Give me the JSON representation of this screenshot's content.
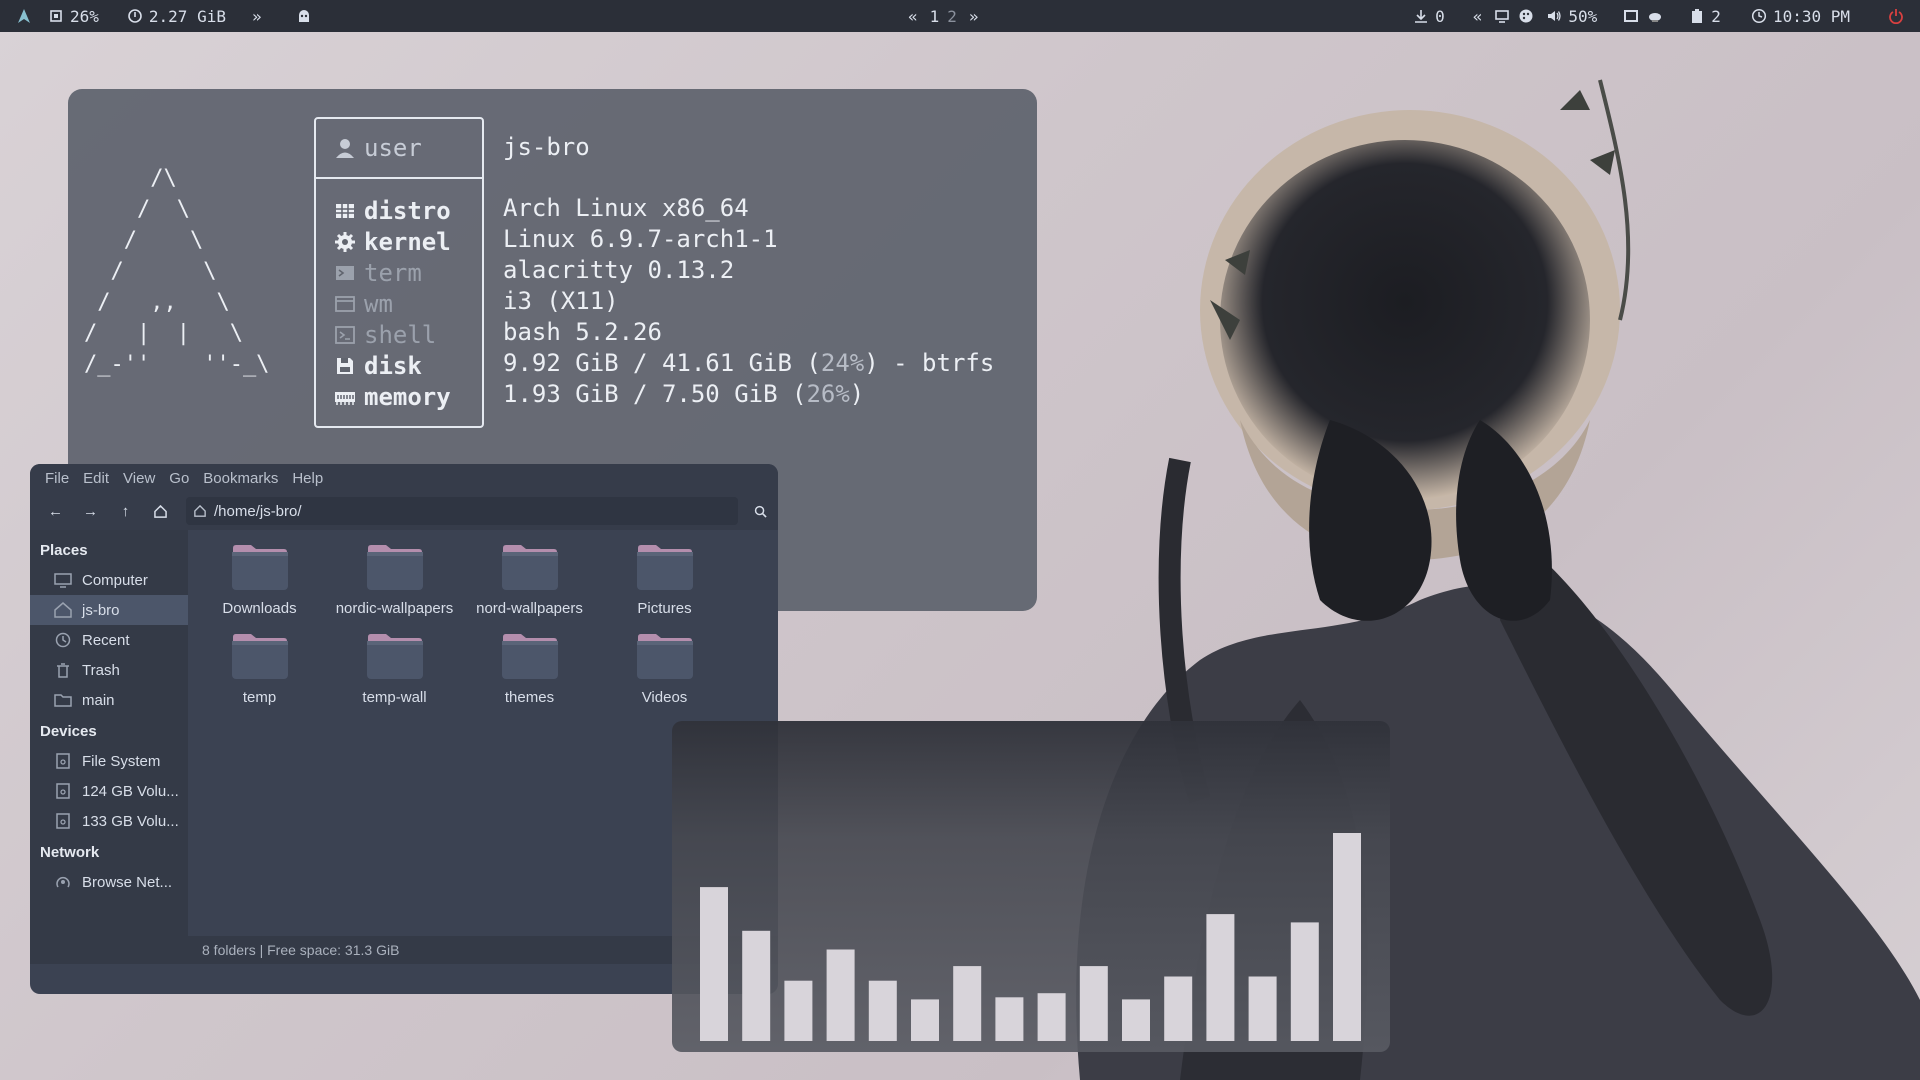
{
  "topbar": {
    "cpu": "26%",
    "mem": "2.27 GiB",
    "workspaces": [
      "1",
      "2"
    ],
    "downloads": "0",
    "volume": "50%",
    "clipboard": "2",
    "clock": "10:30 PM"
  },
  "fetch": {
    "ascii": "     /\\\n    /  \\\n   /    \\\n  /      \\\n /   ,,   \\\n/   |  |   \\\n/_-''    ''-_\\",
    "user_label": "user",
    "user_value": "js-bro",
    "rows": [
      {
        "key": "distro",
        "value": "Arch Linux x86_64",
        "bright": true,
        "icon": "package-icon"
      },
      {
        "key": "kernel",
        "value": "Linux 6.9.7-arch1-1",
        "bright": true,
        "icon": "gear-icon"
      },
      {
        "key": "term",
        "value": "alacritty 0.13.2",
        "bright": false,
        "icon": "terminal-icon"
      },
      {
        "key": "wm",
        "value": "i3 (X11)",
        "bright": false,
        "icon": "window-icon"
      },
      {
        "key": "shell",
        "value": "bash 5.2.26",
        "bright": false,
        "icon": "shell-icon"
      },
      {
        "key": "disk",
        "value_main": "9.92 GiB / 41.61 GiB (",
        "value_pct": "24%",
        "value_tail": ") - btrfs",
        "bright": true,
        "icon": "floppy-icon"
      },
      {
        "key": "memory",
        "value_main": "1.93 GiB / 7.50 GiB (",
        "value_pct": "26%",
        "value_tail": ")",
        "bright": true,
        "icon": "ram-icon"
      }
    ]
  },
  "filemanager": {
    "menus": [
      "File",
      "Edit",
      "View",
      "Go",
      "Bookmarks",
      "Help"
    ],
    "path": "/home/js-bro/",
    "sidebar": {
      "places_title": "Places",
      "places": [
        {
          "label": "Computer",
          "icon": "computer-icon"
        },
        {
          "label": "js-bro",
          "icon": "home-icon",
          "active": true
        },
        {
          "label": "Recent",
          "icon": "recent-icon"
        },
        {
          "label": "Trash",
          "icon": "trash-icon"
        },
        {
          "label": "main",
          "icon": "folder-icon"
        }
      ],
      "devices_title": "Devices",
      "devices": [
        {
          "label": "File System",
          "icon": "drive-icon"
        },
        {
          "label": "124 GB Volu...",
          "icon": "drive-icon"
        },
        {
          "label": "133 GB Volu...",
          "icon": "drive-icon"
        }
      ],
      "network_title": "Network",
      "network": [
        {
          "label": "Browse Net...",
          "icon": "network-icon"
        }
      ]
    },
    "folders": [
      "Downloads",
      "nordic-wallpapers",
      "nord-wallpapers",
      "Pictures",
      "temp",
      "temp-wall",
      "themes",
      "Videos"
    ],
    "status": "8 folders  |  Free space: 31.3 GiB"
  },
  "visualizer": {
    "levels": [
      0.74,
      0.53,
      0.29,
      0.44,
      0.29,
      0.2,
      0.36,
      0.21,
      0.23,
      0.36,
      0.2,
      0.31,
      0.61,
      0.31,
      0.57,
      1.0
    ]
  },
  "colors": {
    "accent_folder": "#b48ead",
    "bar": "#d8d4da",
    "power": "#d94040"
  }
}
